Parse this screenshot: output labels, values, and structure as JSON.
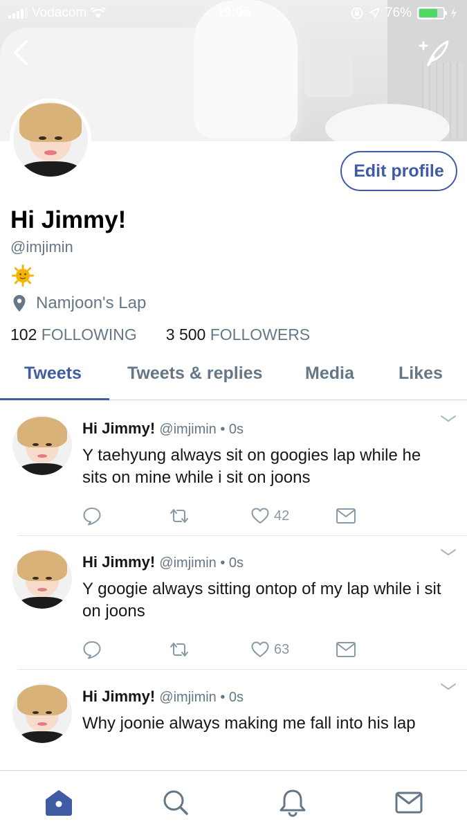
{
  "status_bar": {
    "carrier": "Vodacom",
    "time": "19:05",
    "battery": "76%",
    "battery_level": 0.76
  },
  "profile": {
    "display_name": "Hi Jimmy!",
    "handle": "@imjimin",
    "location": "Namjoon's Lap",
    "following_count": "102",
    "following_label": "FOLLOWING",
    "followers_count": "3 500",
    "followers_label": "FOLLOWERS",
    "edit_button": "Edit profile",
    "bio_emoji_icon": "sun-face-emoji"
  },
  "tabs": [
    {
      "label": "Tweets",
      "active": true
    },
    {
      "label": "Tweets & replies",
      "active": false
    },
    {
      "label": "Media",
      "active": false
    },
    {
      "label": "Likes",
      "active": false
    }
  ],
  "tweets": [
    {
      "name": "Hi Jimmy!",
      "meta": "@imjimin • 0s",
      "text": "Y taehyung always sit on googies lap while he sits on mine while i sit on joons",
      "likes": "42"
    },
    {
      "name": "Hi Jimmy!",
      "meta": "@imjimin • 0s",
      "text": "Y googie always sitting ontop of my lap while i sit on joons",
      "likes": "63"
    },
    {
      "name": "Hi Jimmy!",
      "meta": "@imjimin • 0s",
      "text": "Why joonie always making me fall into his lap",
      "likes": ""
    }
  ],
  "colors": {
    "accent": "#3e5ba4",
    "muted": "#657786",
    "battery": "#4cd964"
  },
  "bottom_nav": [
    "home-icon",
    "search-icon",
    "notifications-bell-icon",
    "messages-envelope-icon"
  ]
}
